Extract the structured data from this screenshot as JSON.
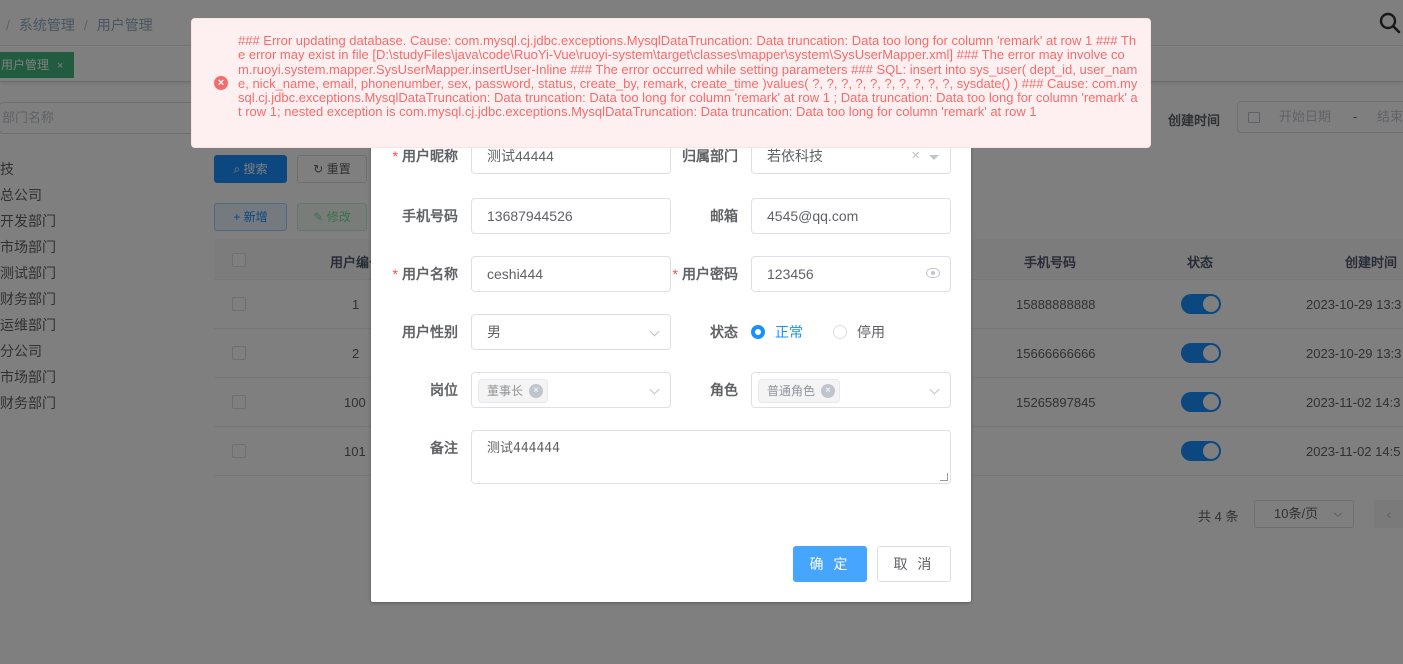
{
  "breadcrumb": {
    "sep": "/",
    "items": [
      "系统管理",
      "用户管理"
    ]
  },
  "tags": {
    "active_label": "用户管理",
    "close_glyph": "×"
  },
  "dept_search": {
    "placeholder": "部门名称"
  },
  "dept_tree": [
    "技",
    "总公司",
    "开发部门",
    "市场部门",
    "测试部门",
    "财务部门",
    "运维部门",
    "分公司",
    "市场部门",
    "财务部门"
  ],
  "filters": {
    "create_time_label": "创建时间",
    "start_placeholder": "开始日期",
    "range_sep": "-",
    "end_placeholder": "结束日期"
  },
  "toolbar": {
    "search_label": "搜索",
    "reset_label": "重置",
    "add_label": "新增",
    "edit_label": "修改",
    "search_icon": "search-icon",
    "reset_icon": "refresh-icon",
    "add_icon": "plus-icon",
    "edit_icon": "edit-icon"
  },
  "table": {
    "columns": {
      "id": "用户编号",
      "phone": "手机号码",
      "status": "状态",
      "created": "创建时间"
    },
    "rows": [
      {
        "id": "1",
        "phone": "15888888888",
        "status": true,
        "created": "2023-10-29 13:3"
      },
      {
        "id": "2",
        "phone": "15666666666",
        "status": true,
        "created": "2023-10-29 13:3"
      },
      {
        "id": "100",
        "phone": "15265897845",
        "status": true,
        "created": "2023-11-02 14:3"
      },
      {
        "id": "101",
        "phone": "",
        "status": true,
        "created": "2023-11-02 14:5"
      }
    ]
  },
  "pagination": {
    "total": "共 4 条",
    "page_size": "10条/页",
    "prev": "‹"
  },
  "dialog": {
    "nickname": {
      "label": "用户昵称",
      "value": "测试44444"
    },
    "dept": {
      "label": "归属部门",
      "value": "若依科技",
      "clear": "×"
    },
    "phone": {
      "label": "手机号码",
      "value": "13687944526"
    },
    "email": {
      "label": "邮箱",
      "value": "4545@qq.com"
    },
    "username": {
      "label": "用户名称",
      "value": "ceshi444"
    },
    "password": {
      "label": "用户密码",
      "value": "123456"
    },
    "sex": {
      "label": "用户性别",
      "value": "男"
    },
    "status": {
      "label": "状态",
      "options": [
        "正常",
        "停用"
      ],
      "selected": "正常"
    },
    "post": {
      "label": "岗位",
      "chip": "董事长"
    },
    "role": {
      "label": "角色",
      "chip": "普通角色"
    },
    "remark": {
      "label": "备注",
      "value": "测试444444"
    },
    "required_mark": "*",
    "ok_label": "确 定",
    "cancel_label": "取 消"
  },
  "error_message": {
    "icon": "error-circle-icon",
    "icon_glyph": "×",
    "text": "### Error updating database. Cause: com.mysql.cj.jdbc.exceptions.MysqlDataTruncation: Data truncation: Data too long for column 'remark' at row 1 ### The error may exist in file [D:\\studyFiles\\java\\code\\RuoYi-Vue\\ruoyi-system\\target\\classes\\mapper\\system\\SysUserMapper.xml] ### The error may involve com.ruoyi.system.mapper.SysUserMapper.insertUser-Inline ### The error occurred while setting parameters ### SQL: insert into sys_user( dept_id, user_name, nick_name, email, phonenumber, sex, password, status, create_by, remark, create_time )values( ?, ?, ?, ?, ?, ?, ?, ?, ?, ?, sysdate() ) ### Cause: com.mysql.cj.jdbc.exceptions.MysqlDataTruncation: Data truncation: Data too long for column 'remark' at row 1 ; Data truncation: Data too long for column 'remark' at row 1; nested exception is com.mysql.cj.jdbc.exceptions.MysqlDataTruncation: Data truncation: Data too long for column 'remark' at row 1"
  },
  "colors": {
    "primary": "#1890ff",
    "danger": "#f56c6c",
    "success": "#42b983"
  }
}
